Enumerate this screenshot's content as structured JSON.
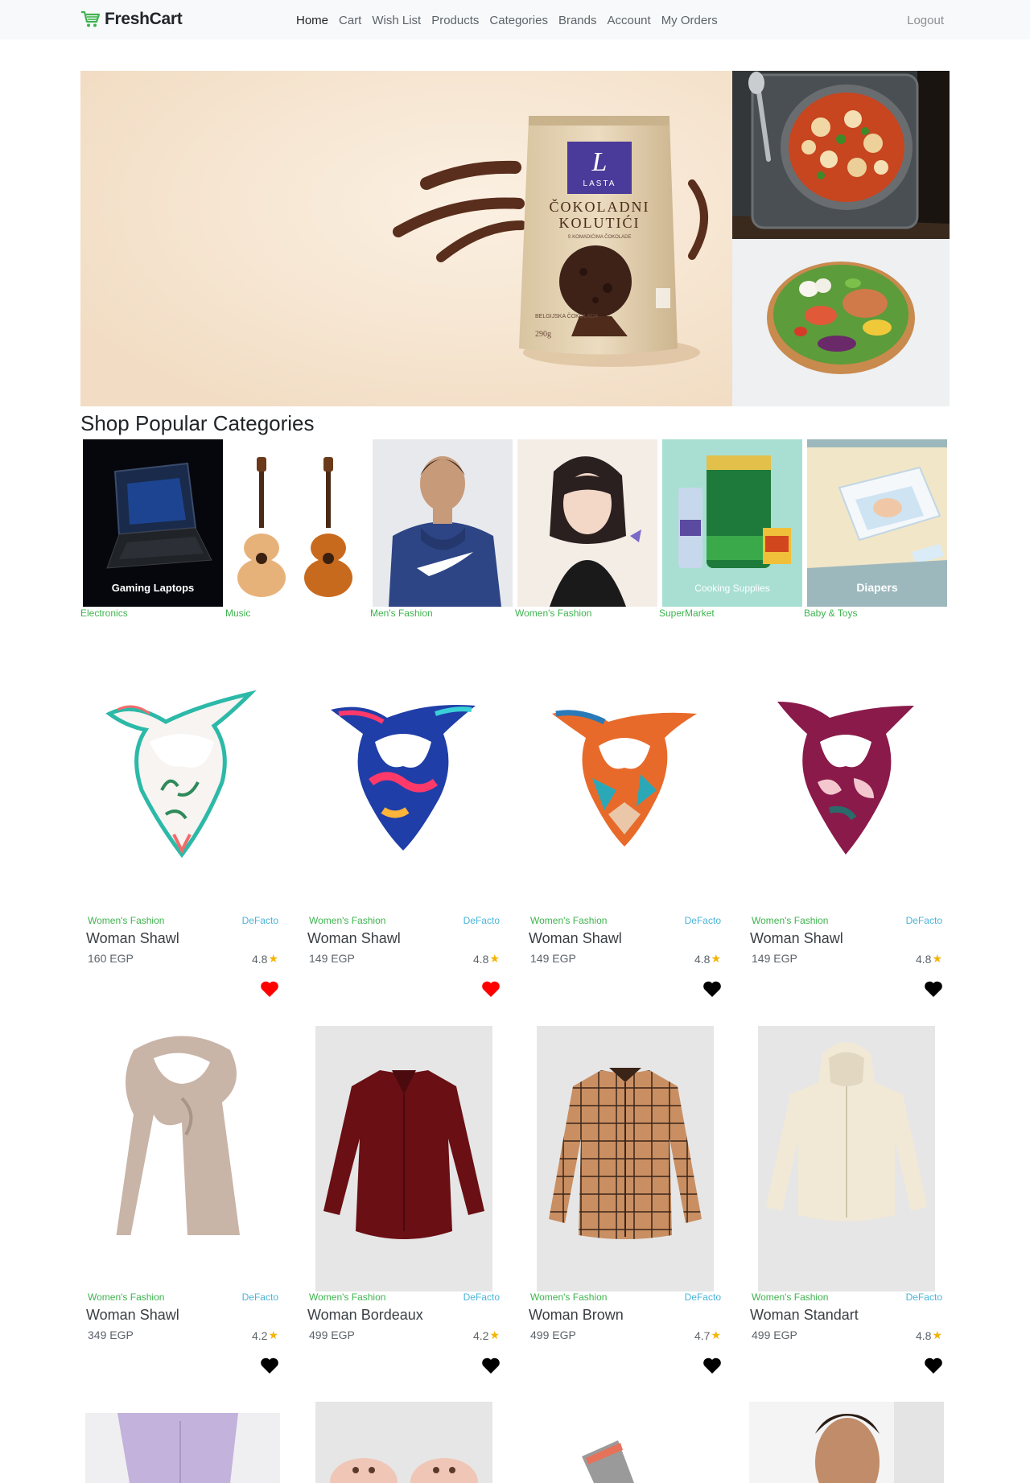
{
  "navbar": {
    "brand": "FreshCart",
    "links": [
      "Home",
      "Cart",
      "Wish List",
      "Products",
      "Categories",
      "Brands",
      "Account",
      "My Orders"
    ],
    "active_link": "Home",
    "logout": "Logout",
    "accent_color": "#3fb34f"
  },
  "hero": {
    "main_slide": {
      "logo_letter": "L",
      "logo_text": "LASTA",
      "product_line1": "ČOKOLADNI",
      "product_line2": "KOLUTIĆI",
      "product_sub": "S KOMADIĆIMA ČOKOLADE",
      "origin": "BELGIJSKA ČOKOLADA",
      "weight": "290g"
    }
  },
  "categories": {
    "title": "Shop Popular Categories",
    "items": [
      {
        "label": "Electronics",
        "image_caption": "Gaming Laptops"
      },
      {
        "label": "Music",
        "image_caption": ""
      },
      {
        "label": "Men's Fashion",
        "image_caption": ""
      },
      {
        "label": "Women's Fashion",
        "image_caption": ""
      },
      {
        "label": "SuperMarket",
        "image_caption": "Cooking Supplies"
      },
      {
        "label": "Baby & Toys",
        "image_caption": "Diapers"
      }
    ]
  },
  "products": [
    {
      "category": "Women's Fashion",
      "brand": "DeFacto",
      "title": "Woman Shawl",
      "price": "160 EGP",
      "rating": "4.8",
      "wishlisted": true
    },
    {
      "category": "Women's Fashion",
      "brand": "DeFacto",
      "title": "Woman Shawl",
      "price": "149 EGP",
      "rating": "4.8",
      "wishlisted": true
    },
    {
      "category": "Women's Fashion",
      "brand": "DeFacto",
      "title": "Woman Shawl",
      "price": "149 EGP",
      "rating": "4.8",
      "wishlisted": false
    },
    {
      "category": "Women's Fashion",
      "brand": "DeFacto",
      "title": "Woman Shawl",
      "price": "149 EGP",
      "rating": "4.8",
      "wishlisted": false
    },
    {
      "category": "Women's Fashion",
      "brand": "DeFacto",
      "title": "Woman Shawl",
      "price": "349 EGP",
      "rating": "4.2",
      "wishlisted": false
    },
    {
      "category": "Women's Fashion",
      "brand": "DeFacto",
      "title": "Woman Bordeaux",
      "price": "499 EGP",
      "rating": "4.2",
      "wishlisted": false
    },
    {
      "category": "Women's Fashion",
      "brand": "DeFacto",
      "title": "Woman Brown",
      "price": "499 EGP",
      "rating": "4.7",
      "wishlisted": false
    },
    {
      "category": "Women's Fashion",
      "brand": "DeFacto",
      "title": "Woman Standart",
      "price": "499 EGP",
      "rating": "4.8",
      "wishlisted": false
    }
  ],
  "colors": {
    "category_text": "#3fb34f",
    "brand_text": "#4bb4d8",
    "star": "#f4b400",
    "heart_active": "#ff0000",
    "heart_inactive": "#000000"
  }
}
